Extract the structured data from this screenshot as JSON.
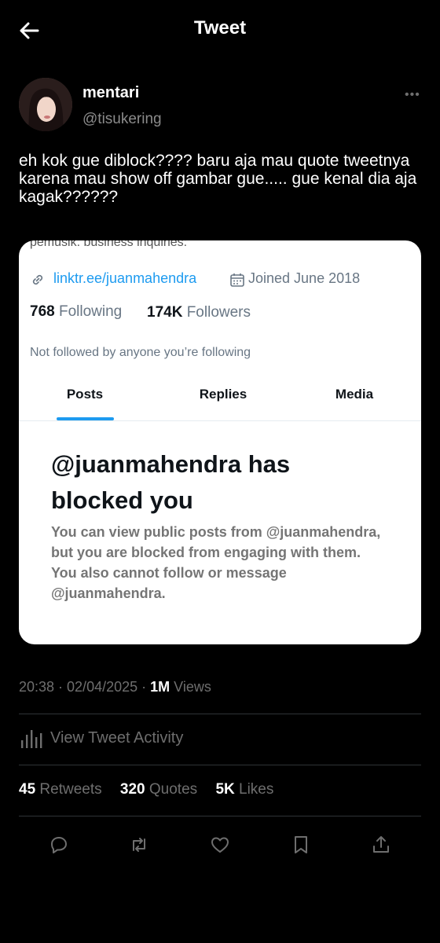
{
  "header": {
    "title": "Tweet"
  },
  "tweet": {
    "author_name": "mentari",
    "author_handle": "@tisukering",
    "more_label": "•••",
    "text": "eh kok gue diblock???? baru aja mau quote tweetnya karena mau show off gambar gue..... gue kenal dia aja kagak??????",
    "timestamp": "20:38 · 02/04/2025 · ",
    "views_count": "1M",
    "views_label": " Views"
  },
  "embedded_screenshot": {
    "cut_text": "pemusik. business inquiries:",
    "link": "linktr.ee/juanmahendra",
    "joined": "Joined June 2018",
    "following_count": "768",
    "following_label": " Following",
    "followers_count": "174K",
    "followers_label": " Followers",
    "not_followed": "Not followed by anyone you’re following",
    "tabs": [
      "Posts",
      "Replies",
      "Media"
    ],
    "blocked_title": "@juanmahendra has blocked you",
    "blocked_body": "You can view public posts from @juanmahendra, but you are blocked from engaging with them. You also cannot follow or message @juanmahendra."
  },
  "activity": {
    "label": "View Tweet Activity"
  },
  "stats": {
    "retweets_count": "45",
    "retweets_label": " Retweets",
    "quotes_count": "320",
    "quotes_label": " Quotes",
    "likes_count": "5K",
    "likes_label": " Likes"
  },
  "actions": [
    "reply-icon",
    "retweet-icon",
    "like-icon",
    "bookmark-icon",
    "share-icon"
  ],
  "colors": {
    "background": "#000000",
    "link": "#1d9bf0",
    "muted": "#6e6e6e"
  }
}
